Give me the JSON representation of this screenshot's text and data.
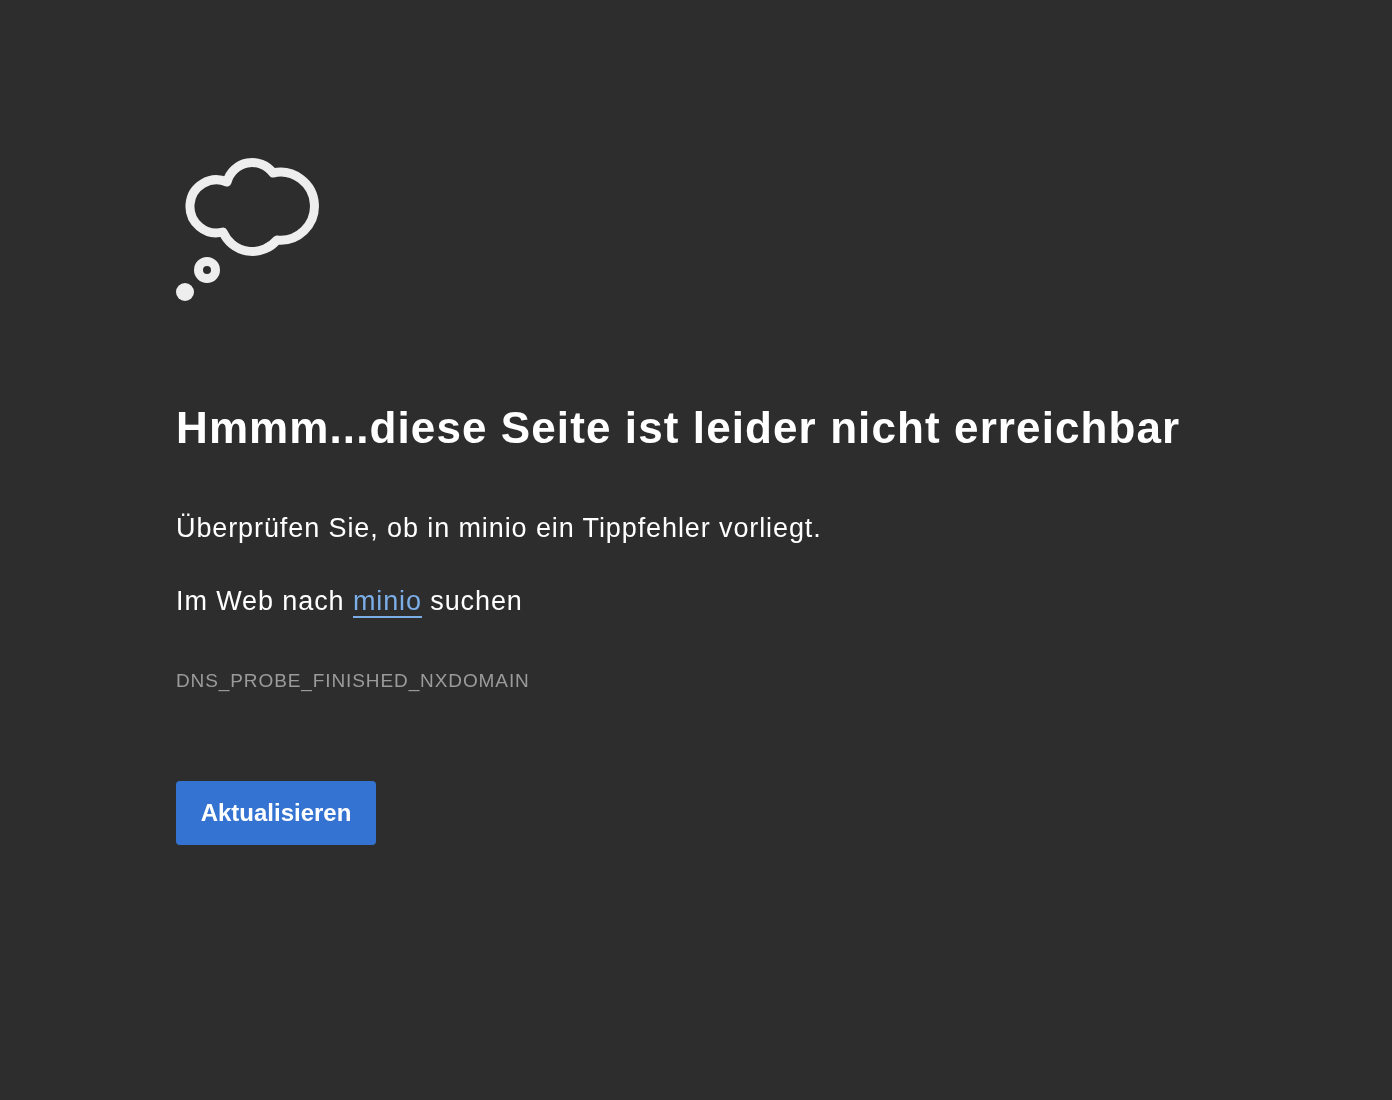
{
  "heading": "Hmmm...diese Seite ist leider nicht erreichbar",
  "message": "Überprüfen Sie, ob in minio ein Tippfehler vorliegt.",
  "search_suggestion": {
    "prefix": "Im Web nach",
    "link": "minio",
    "suffix": "suchen"
  },
  "error_code": "DNS_PROBE_FINISHED_NXDOMAIN",
  "button": "Aktualisieren"
}
